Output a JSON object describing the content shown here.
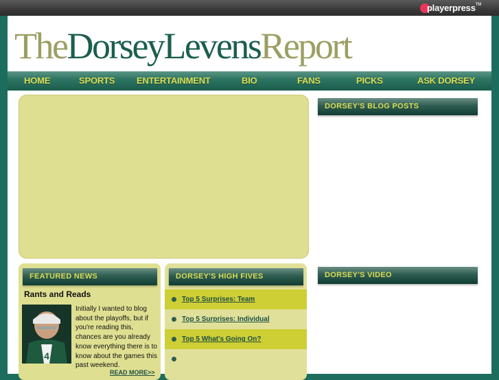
{
  "topbar": {
    "brand": "playerpress",
    "trademark": "TM"
  },
  "masthead": {
    "title_the": "The",
    "title_name": "DorseyLevens",
    "title_report": "Report"
  },
  "nav": {
    "items": [
      {
        "label": "HOME"
      },
      {
        "label": "SPORTS"
      },
      {
        "label": "ENTERTAINMENT"
      },
      {
        "label": "BIO"
      },
      {
        "label": "FANS"
      },
      {
        "label": "PICKS"
      },
      {
        "label": "ASK DORSEY"
      }
    ]
  },
  "featured": {
    "heading": "FEATURED NEWS",
    "title": "Rants and Reads",
    "body": "Initially I wanted to blog about the playoffs, but if you're reading this, chances are you already know everything there is to know about the games this past weekend.",
    "read_more": "READ MORE>>"
  },
  "high_fives": {
    "heading": "DORSEY'S HIGH FIVES",
    "items": [
      {
        "label": "Top 5 Surprises: Team"
      },
      {
        "label": "Top 5 Surprises: Individual"
      },
      {
        "label": "Top 5 What's Going On?"
      },
      {
        "label": ""
      }
    ]
  },
  "sidebar": {
    "blog_heading": "DORSEY'S BLOG POSTS",
    "video_heading": "DORSEY'S VIDEO"
  },
  "colors": {
    "background": "#1d6d5f",
    "accent": "#d8dc55",
    "panel": "#dfdf92",
    "highlight_row": "#cece35",
    "brand_green": "#1b5e4d",
    "brand_olive": "#9c9f63"
  }
}
